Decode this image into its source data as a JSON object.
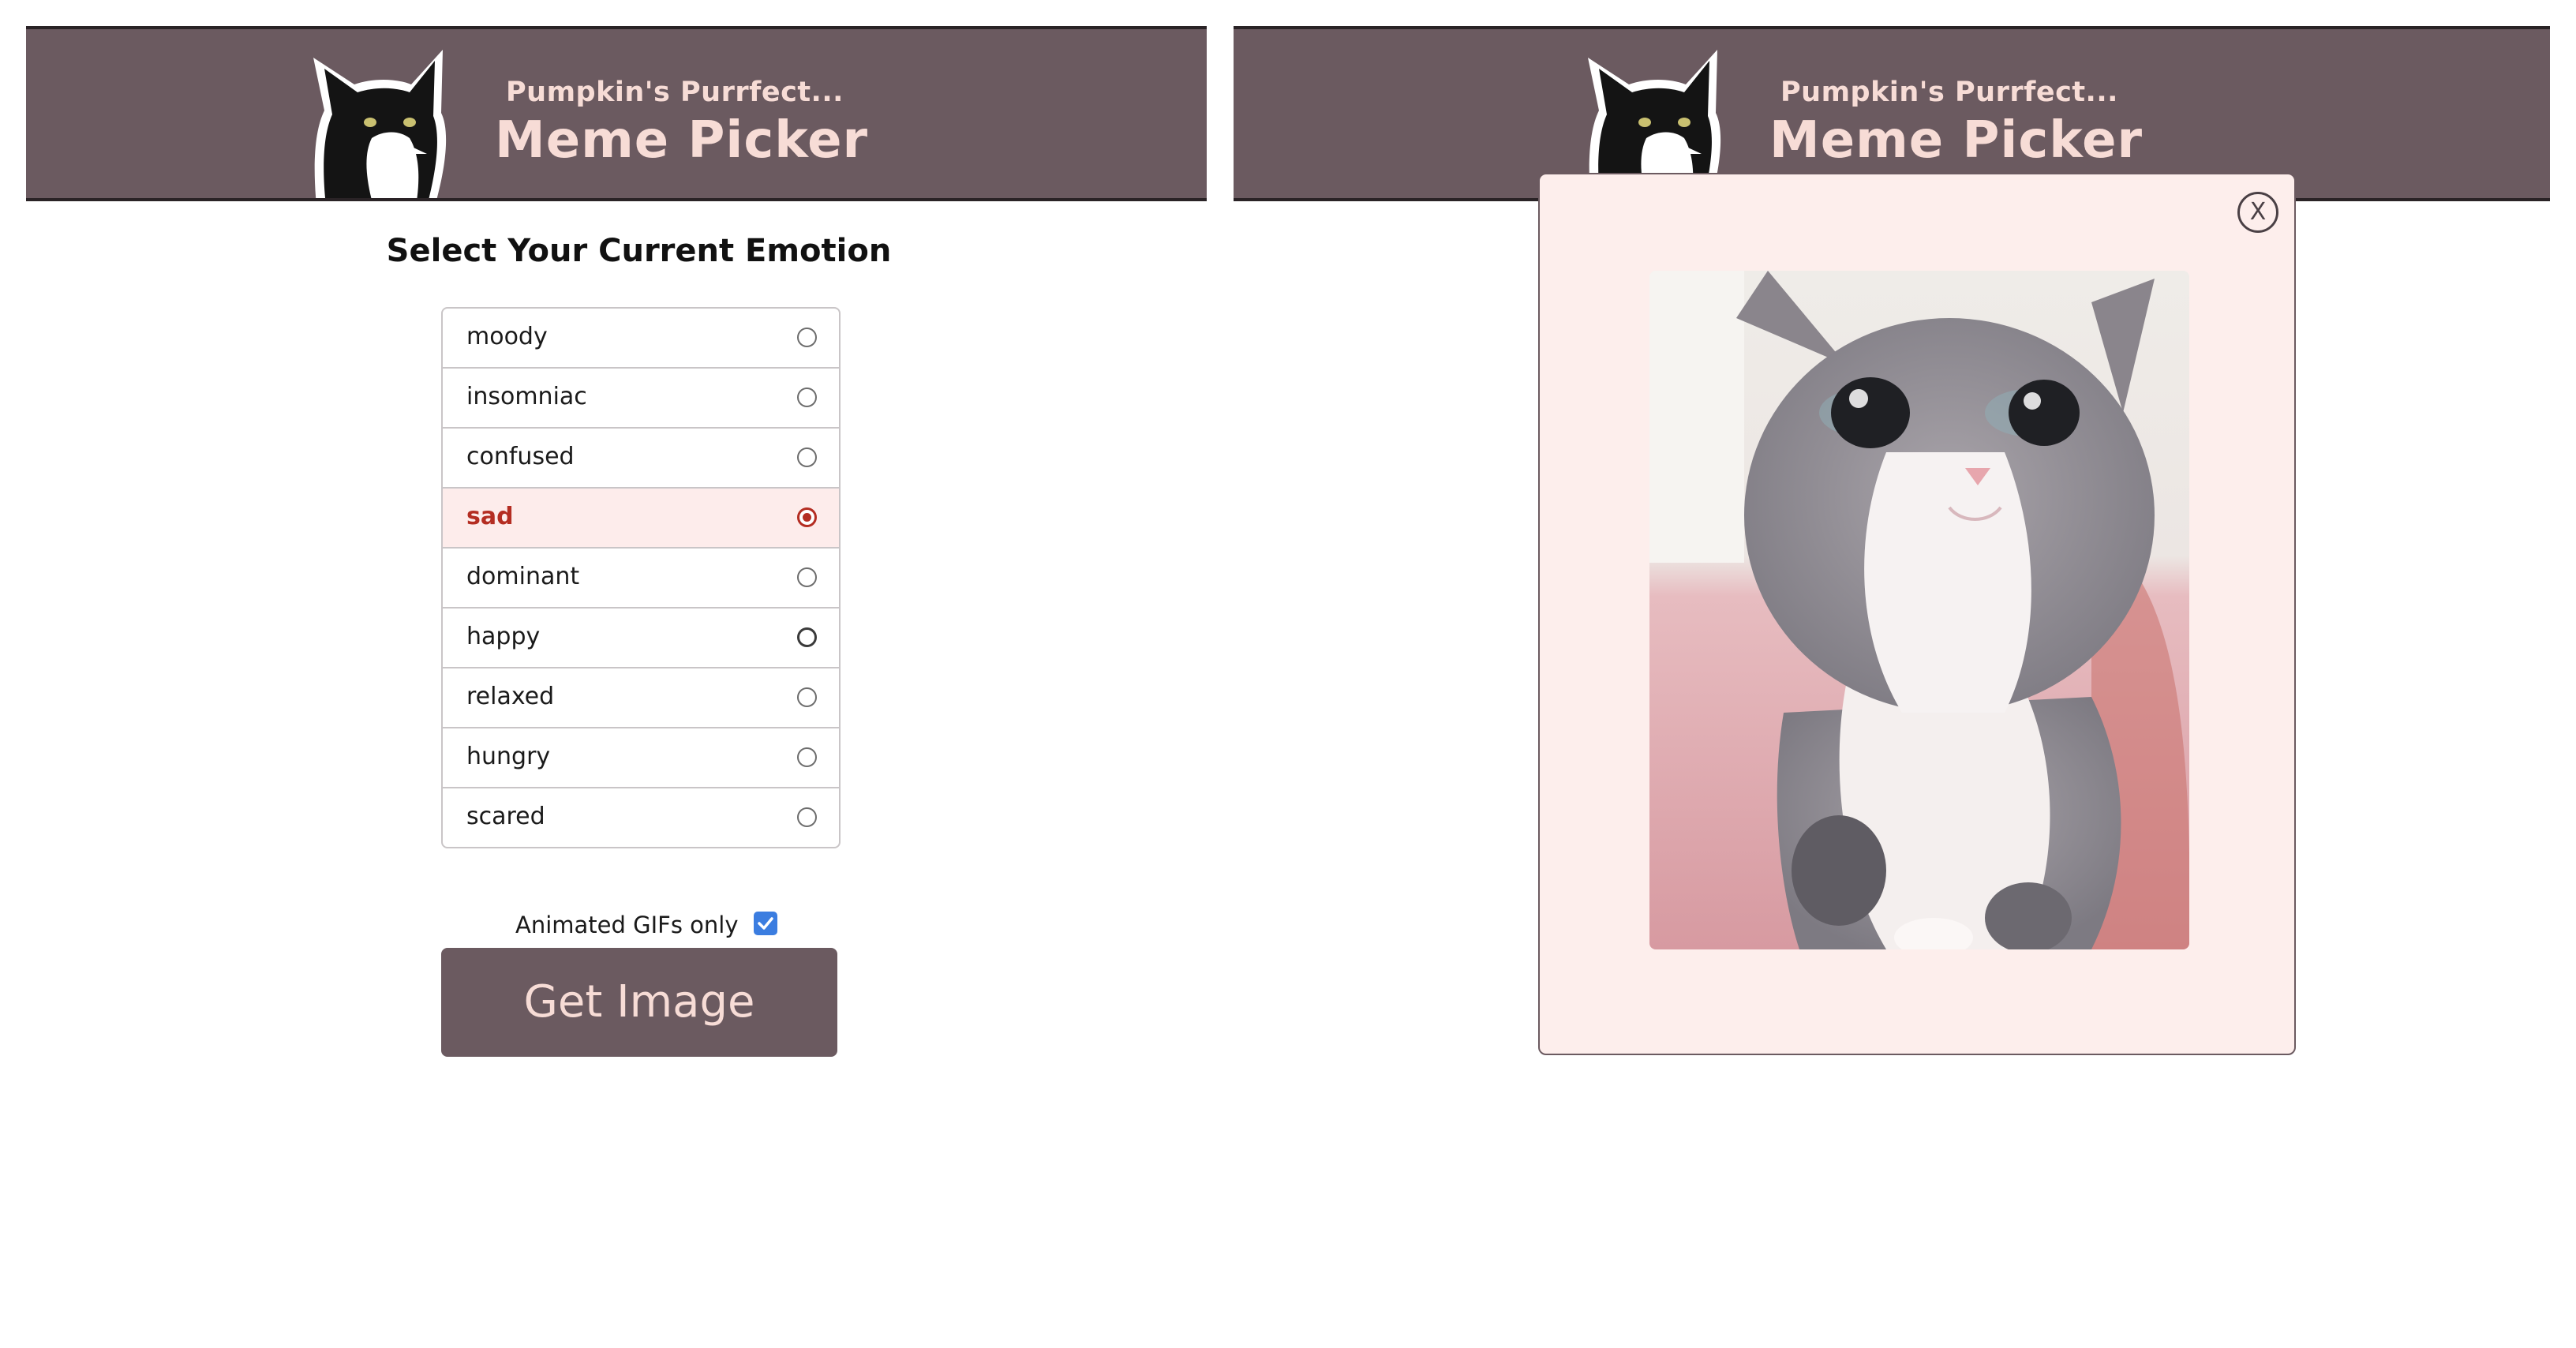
{
  "left_screen": {
    "header": {
      "subtitle": "Pumpkin's Purrfect...",
      "title": "Meme Picker",
      "logo_icon": "tuxedo-cat-logo"
    },
    "heading": "Select Your Current Emotion",
    "emotions": [
      {
        "label": "moody",
        "selected": false
      },
      {
        "label": "insomniac",
        "selected": false
      },
      {
        "label": "confused",
        "selected": false
      },
      {
        "label": "sad",
        "selected": true
      },
      {
        "label": "dominant",
        "selected": false
      },
      {
        "label": "happy",
        "selected": false
      },
      {
        "label": "relaxed",
        "selected": false
      },
      {
        "label": "hungry",
        "selected": false
      },
      {
        "label": "scared",
        "selected": false
      }
    ],
    "gif_toggle": {
      "label": "Animated GIFs only",
      "checked": true
    },
    "get_image_button": "Get Image"
  },
  "right_screen": {
    "header": {
      "subtitle": "Pumpkin's Purrfect...",
      "title": "Meme Picker",
      "logo_icon": "tuxedo-cat-logo"
    },
    "modal": {
      "close_label": "X",
      "image_icon": "sad-kitten-image"
    }
  },
  "colors": {
    "header_bg": "#6b5a60",
    "header_text": "#f7dcd6",
    "selected_accent": "#b42d22",
    "selected_row_bg": "#fdeceb",
    "modal_bg": "#fdeeec",
    "checkbox_blue": "#3b7de0"
  }
}
